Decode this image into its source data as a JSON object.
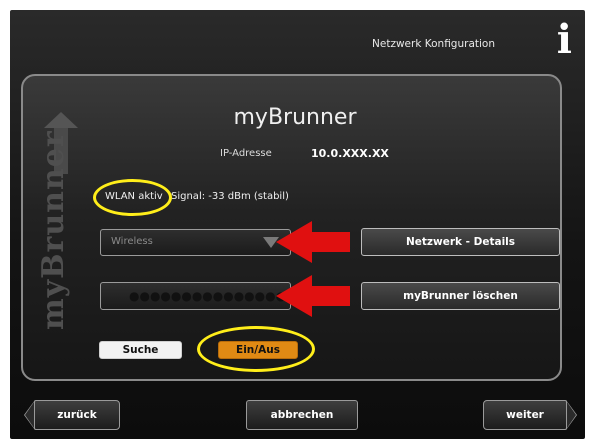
{
  "header": {
    "title": "Netzwerk Konfiguration",
    "info_icon": "i"
  },
  "side_brand": "myBrunner",
  "device": {
    "name": "myBrunner",
    "ip_label": "IP-Adresse",
    "ip_value": "10.0.XXX.XX"
  },
  "wlan": {
    "status": "WLAN aktiv",
    "signal": "Signal: -33 dBm (stabil)"
  },
  "network_select": {
    "value": "Wireless"
  },
  "password_field": {
    "value": "●●●●●●●●●●●●●●●"
  },
  "buttons": {
    "details": "Netzwerk - Details",
    "delete": "myBrunner löschen",
    "search": "Suche",
    "onoff": "Ein/Aus"
  },
  "footer": {
    "back": "zurück",
    "cancel": "abbrechen",
    "next": "weiter"
  },
  "colors": {
    "background": "#141414",
    "accent_orange": "#e08a14",
    "annotation_yellow": "#ffee1a",
    "annotation_red": "#e01010"
  },
  "icons": [
    "info-icon",
    "dropdown-arrow-icon",
    "up-arrow-icon",
    "back-chevron-icon",
    "next-chevron-icon"
  ]
}
